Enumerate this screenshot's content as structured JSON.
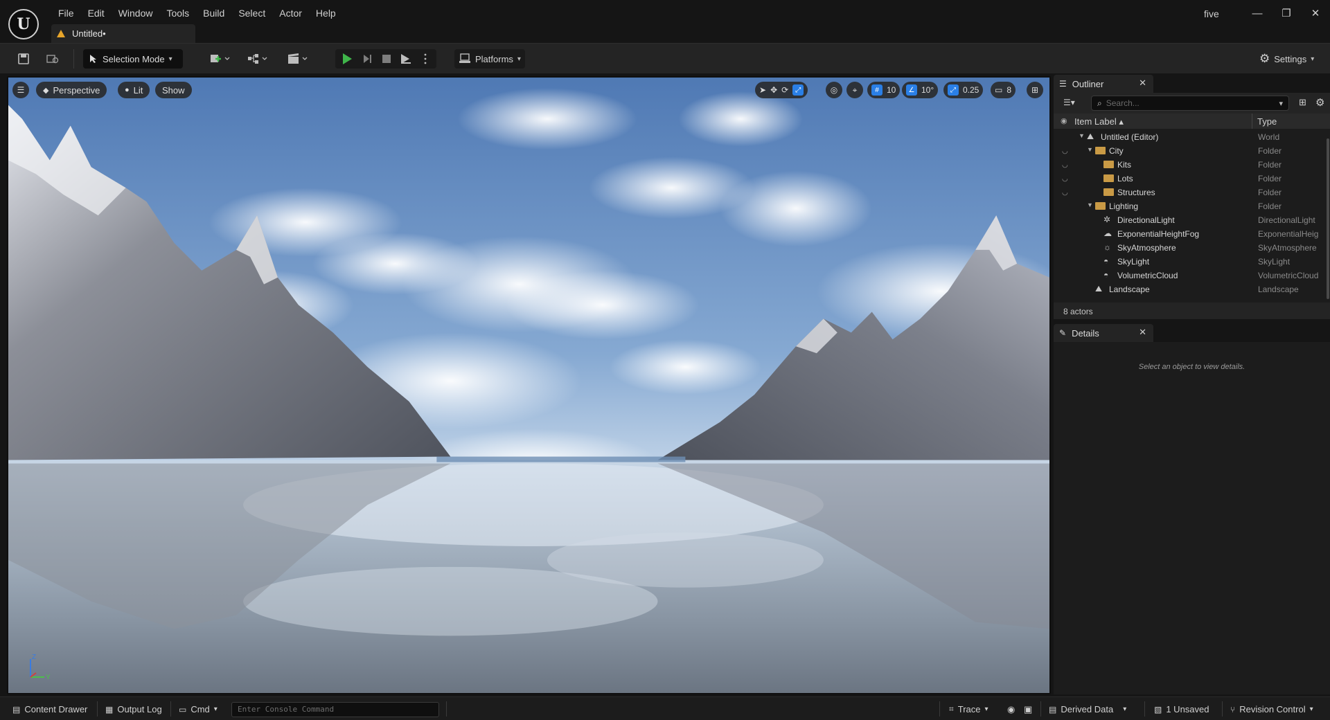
{
  "app": {
    "project_name": "five",
    "document_tab": "Untitled•"
  },
  "menu": [
    "File",
    "Edit",
    "Window",
    "Tools",
    "Build",
    "Select",
    "Actor",
    "Help"
  ],
  "window_controls": [
    "—",
    "❐",
    "✕"
  ],
  "toolbar": {
    "selection_mode": "Selection Mode",
    "platforms": "Platforms",
    "settings": "Settings"
  },
  "viewport": {
    "perspective": "Perspective",
    "lit": "Lit",
    "show": "Show",
    "grid_snap": "10",
    "rotation_snap": "10°",
    "scale_snap": "0.25",
    "camera_speed": "8",
    "axis_z": "Z",
    "axis_y": "Y"
  },
  "outliner": {
    "title": "Outliner",
    "search_placeholder": "Search...",
    "col_label": "Item Label ▴",
    "col_type": "Type",
    "rows": [
      {
        "label": "Untitled (Editor)",
        "type": "World"
      },
      {
        "label": "City",
        "type": "Folder"
      },
      {
        "label": "Kits",
        "type": "Folder"
      },
      {
        "label": "Lots",
        "type": "Folder"
      },
      {
        "label": "Structures",
        "type": "Folder"
      },
      {
        "label": "Lighting",
        "type": "Folder"
      },
      {
        "label": "DirectionalLight",
        "type": "DirectionalLight"
      },
      {
        "label": "ExponentialHeightFog",
        "type": "ExponentialHeig"
      },
      {
        "label": "SkyAtmosphere",
        "type": "SkyAtmosphere"
      },
      {
        "label": "SkyLight",
        "type": "SkyLight"
      },
      {
        "label": "VolumetricCloud",
        "type": "VolumetricCloud"
      },
      {
        "label": "Landscape",
        "type": "Landscape"
      }
    ],
    "footer": "8 actors"
  },
  "details": {
    "title": "Details",
    "empty_message": "Select an object to view details."
  },
  "statusbar": {
    "content_drawer": "Content Drawer",
    "output_log": "Output Log",
    "cmd": "Cmd",
    "console_placeholder": "Enter Console Command",
    "trace": "Trace",
    "derived_data": "Derived Data",
    "unsaved": "1 Unsaved",
    "revision_control": "Revision Control"
  },
  "colors": {
    "accent_blue": "#2a7fe6",
    "play_green": "#3fb54a",
    "folder": "#c99a45",
    "panel_bg": "#1c1c1c"
  }
}
